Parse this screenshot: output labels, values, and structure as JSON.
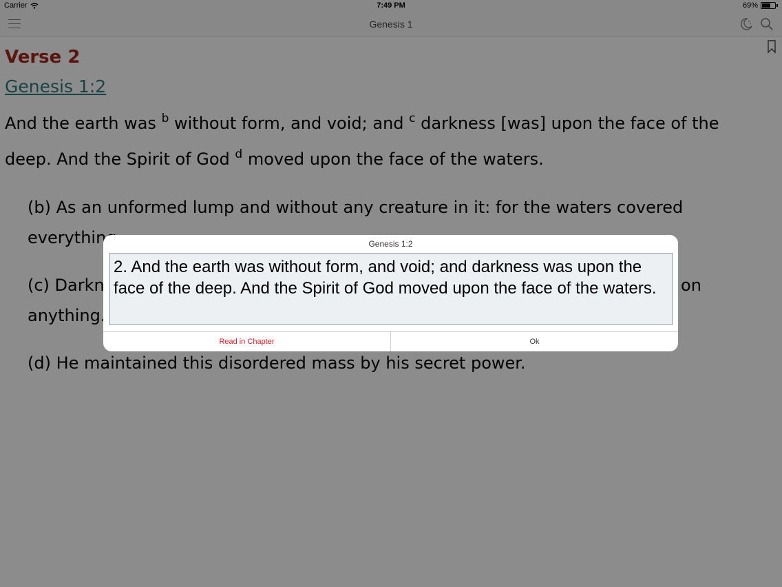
{
  "status_bar": {
    "carrier": "Carrier",
    "time": "7:49 PM",
    "battery_text": "69%",
    "battery_level": 0.69
  },
  "nav": {
    "title": "Genesis 1",
    "icons": [
      "menu-icon",
      "night-mode-icon",
      "search-icon",
      "bookmark-icon"
    ]
  },
  "content": {
    "heading": "Verse 2",
    "reference": "Genesis 1:2",
    "verse": {
      "part1": "And the earth was ",
      "sup_b": "b",
      "part2": " without form, and void; and ",
      "sup_c": "c",
      "part3": " darkness [was] upon the face of the deep. And the Spirit of God ",
      "sup_d": "d",
      "part4": " moved upon the face of the waters."
    },
    "notes": [
      "(b) As an unformed lump and without any creature in it: for the waters covered everything.",
      "(c) Darkness covered the deep waters, for the light was not yet made to shine on anything.",
      "(d) He maintained this disordered mass by his secret power."
    ]
  },
  "dialog": {
    "title": "Genesis 1:2",
    "text": "2. And the earth was without form, and void; and darkness was upon the face of the deep. And the Spirit of God moved upon the face of the waters.",
    "read_label": "Read in Chapter",
    "ok_label": "Ok"
  },
  "colors": {
    "heading": "#a0281b",
    "reference": "#2e7a7e",
    "read_button": "#e01b24"
  }
}
